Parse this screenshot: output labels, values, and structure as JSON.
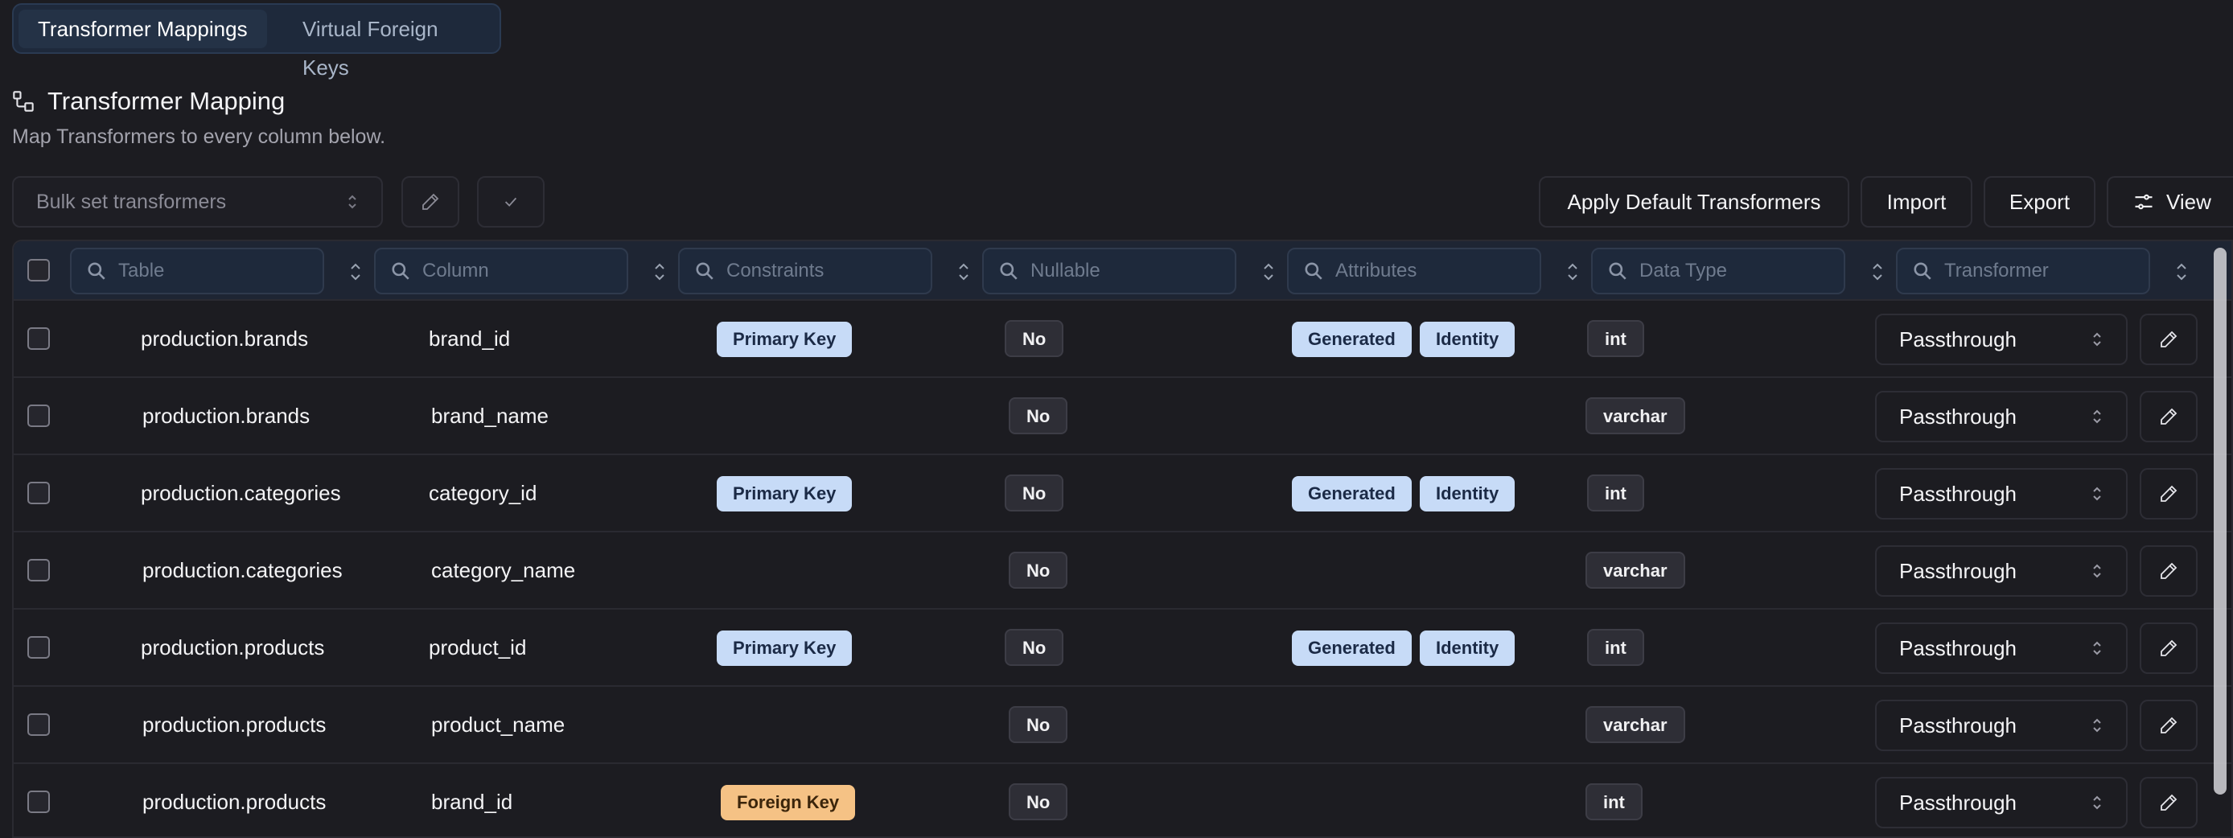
{
  "tabs": [
    {
      "label": "Transformer Mappings",
      "active": true
    },
    {
      "label": "Virtual Foreign Keys",
      "active": false
    }
  ],
  "section": {
    "title": "Transformer Mapping",
    "subtitle": "Map Transformers to every column below.",
    "icon": "schema-icon"
  },
  "toolbar": {
    "bulk_placeholder": "Bulk set transformers",
    "apply_default_label": "Apply Default Transformers",
    "import_label": "Import",
    "export_label": "Export",
    "view_label": "View"
  },
  "columns": [
    {
      "placeholder": "Table"
    },
    {
      "placeholder": "Column"
    },
    {
      "placeholder": "Constraints"
    },
    {
      "placeholder": "Nullable"
    },
    {
      "placeholder": "Attributes"
    },
    {
      "placeholder": "Data Type"
    },
    {
      "placeholder": "Transformer"
    }
  ],
  "rows": [
    {
      "table": "production.brands",
      "column": "brand_id",
      "constraint": "Primary Key",
      "nullable": "No",
      "attributes": [
        "Generated",
        "Identity"
      ],
      "data_type": "int",
      "transformer": "Passthrough"
    },
    {
      "table": "production.brands",
      "column": "brand_name",
      "constraint": "",
      "nullable": "No",
      "attributes": [],
      "data_type": "varchar",
      "transformer": "Passthrough"
    },
    {
      "table": "production.categories",
      "column": "category_id",
      "constraint": "Primary Key",
      "nullable": "No",
      "attributes": [
        "Generated",
        "Identity"
      ],
      "data_type": "int",
      "transformer": "Passthrough"
    },
    {
      "table": "production.categories",
      "column": "category_name",
      "constraint": "",
      "nullable": "No",
      "attributes": [],
      "data_type": "varchar",
      "transformer": "Passthrough"
    },
    {
      "table": "production.products",
      "column": "product_id",
      "constraint": "Primary Key",
      "nullable": "No",
      "attributes": [
        "Generated",
        "Identity"
      ],
      "data_type": "int",
      "transformer": "Passthrough"
    },
    {
      "table": "production.products",
      "column": "product_name",
      "constraint": "",
      "nullable": "No",
      "attributes": [],
      "data_type": "varchar",
      "transformer": "Passthrough"
    },
    {
      "table": "production.products",
      "column": "brand_id",
      "constraint": "Foreign Key",
      "nullable": "No",
      "attributes": [],
      "data_type": "int",
      "transformer": "Passthrough"
    }
  ],
  "colors": {
    "background": "#1c1c21",
    "primary_key_badge": "#c7dbf7",
    "foreign_key_badge": "#f5c285",
    "header_bg": "#1e2533"
  }
}
